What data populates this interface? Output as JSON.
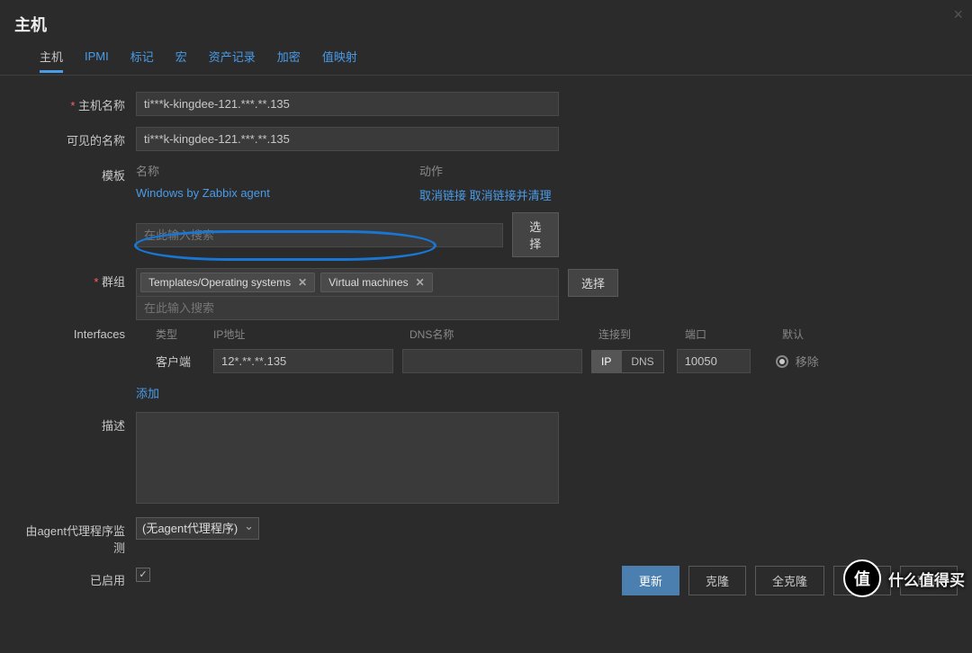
{
  "title": "主机",
  "tabs": [
    "主机",
    "IPMI",
    "标记",
    "宏",
    "资产记录",
    "加密",
    "值映射"
  ],
  "labels": {
    "host_name": "主机名称",
    "visible_name": "可见的名称",
    "templates": "模板",
    "tpl_name": "名称",
    "tpl_action": "动作",
    "unlink": "取消链接",
    "unlink_clear": "取消链接并清理",
    "select": "选择",
    "search_placeholder": "在此输入搜索",
    "groups": "群组",
    "interfaces": "Interfaces",
    "col_type": "类型",
    "col_ip": "IP地址",
    "col_dns": "DNS名称",
    "col_conn": "连接到",
    "col_port": "端口",
    "col_default": "默认",
    "if_agent": "客户端",
    "conn_ip": "IP",
    "conn_dns": "DNS",
    "remove": "移除",
    "add": "添加",
    "desc": "描述",
    "proxy_label": "由agent代理程序监测",
    "enabled": "已启用"
  },
  "fields": {
    "host_name": "ti***k-kingdee-121.***.**.135",
    "visible_name": "ti***k-kingdee-121.***.**.135",
    "template_linked": "Windows by Zabbix agent",
    "groups": [
      {
        "label": "Templates/Operating systems"
      },
      {
        "label": "Virtual machines"
      }
    ],
    "ip": "12*.**.**.135",
    "dns": "",
    "port": "10050",
    "proxy_select": "(无agent代理程序)",
    "enabled": true
  },
  "footer": {
    "update": "更新",
    "clone": "克隆",
    "full_clone": "全克隆",
    "delete": "删除",
    "cancel": "取消"
  },
  "watermark": {
    "icon": "值",
    "text": "什么值得买"
  }
}
